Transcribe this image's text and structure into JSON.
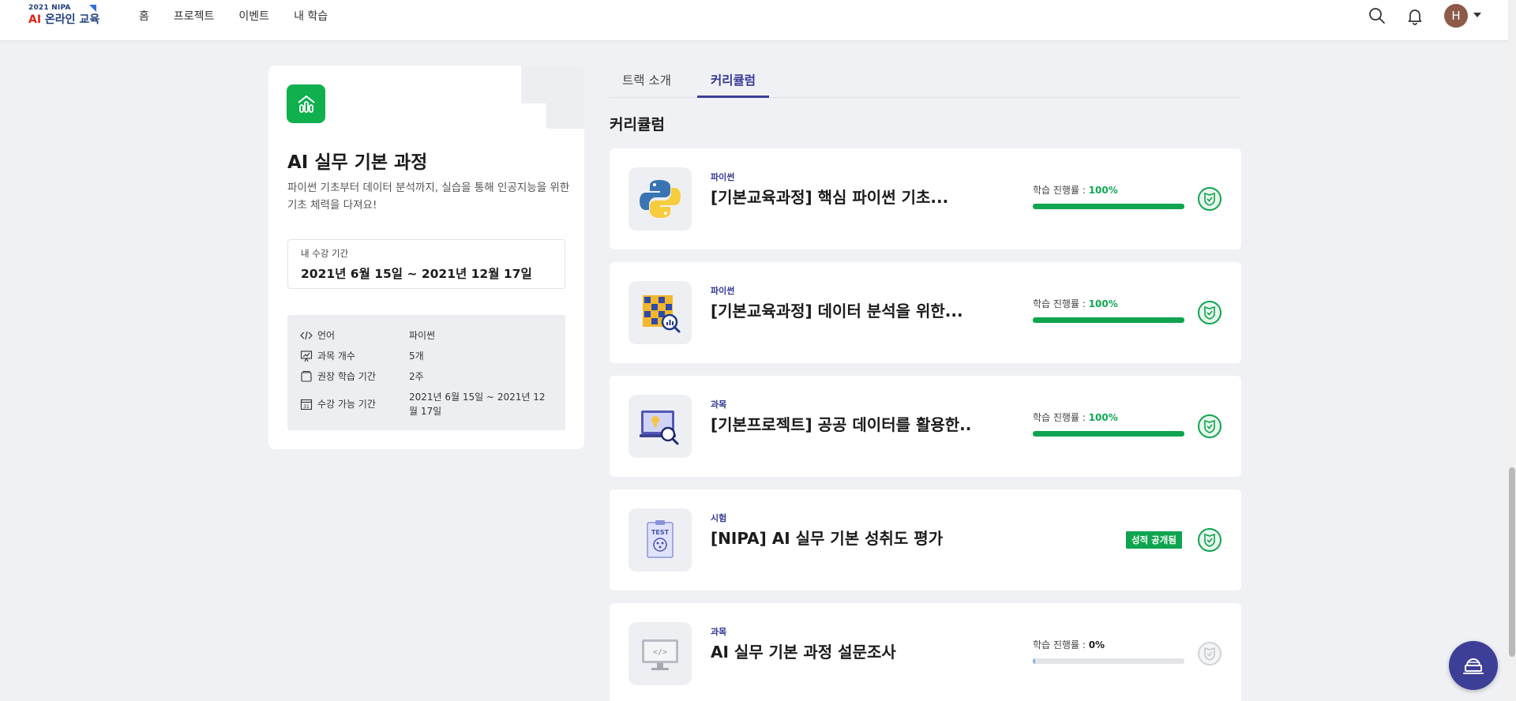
{
  "header": {
    "logo_year": "2021 NIPA",
    "logo_ai": "AI",
    "logo_text": "온라인 교육",
    "nav": [
      "홈",
      "프로젝트",
      "이벤트",
      "내 학습"
    ],
    "avatar_initial": "H"
  },
  "track": {
    "title": "AI 실무 기본 과정",
    "description": "파이썬 기초부터 데이터 분석까지, 실습을 통해 인공지능을 위한 기초 체력을 다져요!",
    "period_label": "내 수강 기간",
    "period_value": "2021년 6월 15일 ~ 2021년 12월 17일",
    "info": [
      {
        "icon": "code-icon",
        "key": "언어",
        "value": "파이썬"
      },
      {
        "icon": "presentation-icon",
        "key": "과목 개수",
        "value": "5개"
      },
      {
        "icon": "book-icon",
        "key": "권장 학습 기간",
        "value": "2주"
      },
      {
        "icon": "calendar-icon",
        "key": "수강 가능 기간",
        "value": "2021년 6월 15일 ~ 2021년 12월 17일"
      }
    ]
  },
  "tabs": [
    "트랙 소개",
    "커리큘럼"
  ],
  "section_title": "커리큘럼",
  "progress_label": "학습 진행률 : ",
  "courses": [
    {
      "category": "파이썬",
      "title": "[기본교육과정] 핵심 파이썬 기초...",
      "progress": "100%",
      "progress_value": 1.0,
      "thumb": "python-logo-icon"
    },
    {
      "category": "파이썬",
      "title": "[기본교육과정] 데이터 분석을 위한...",
      "progress": "100%",
      "progress_value": 1.0,
      "thumb": "data-analysis-icon"
    },
    {
      "category": "과목",
      "title": "[기본프로젝트] 공공 데이터를 활용한...",
      "progress": "100%",
      "progress_value": 1.0,
      "thumb": "monitor-search-icon"
    },
    {
      "category": "시험",
      "title": "[NIPA] AI 실무 기본 성취도 평가",
      "grade_tag": "성적 공개됨",
      "thumb": "test-clipboard-icon"
    },
    {
      "category": "과목",
      "title": "AI 실무 기본 과정 설문조사",
      "progress": "0%",
      "progress_value": 0.0,
      "thumb": "monitor-code-icon"
    }
  ],
  "colors": {
    "accent": "#343a95",
    "green": "#10a855",
    "bg": "#f0f1f4"
  }
}
